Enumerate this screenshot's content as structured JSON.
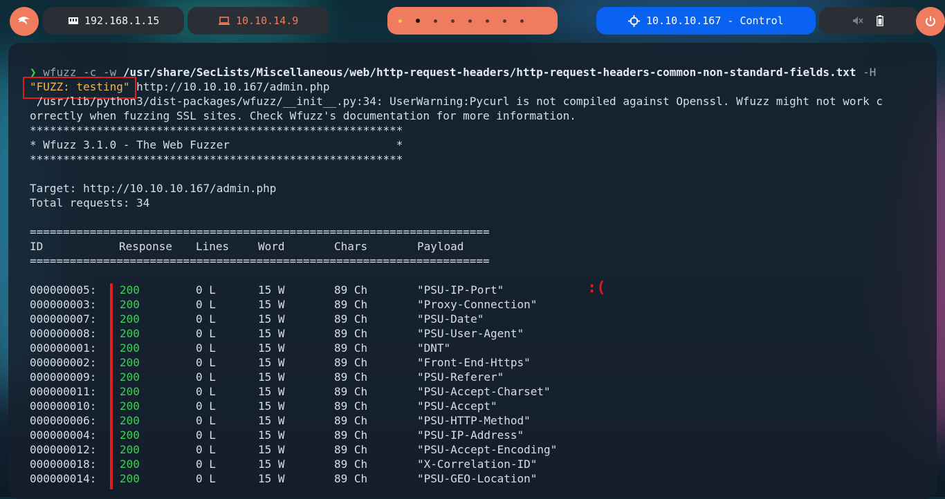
{
  "topbar": {
    "ip_local": "192.168.1.15",
    "ip_vpn": "10.10.14.9",
    "target_label": "10.10.10.167 - Control",
    "workspaces": 8,
    "active_workspace": 2,
    "colors": {
      "accent": "#f07c60",
      "blue": "#0a63f0",
      "dark": "#2a2f36"
    }
  },
  "terminal": {
    "prompt_symbol": "❯",
    "cmd_name": "wfuzz",
    "cmd_flags": " -c -w ",
    "cmd_path": "/usr/share/SecLists/Miscellaneous/web/http-request-headers/http-request-headers-common-non-standard-fields.txt",
    "cmd_h": " -H",
    "cmd_fuzz": "\"FUZZ: testing\"",
    "cmd_url": " http://10.10.10.167/admin.php",
    "warning_1": " /usr/lib/python3/dist-packages/wfuzz/__init__.py:34: UserWarning:Pycurl is not compiled against Openssl. Wfuzz might not work c",
    "warning_2": "orrectly when fuzzing SSL sites. Check Wfuzz's documentation for more information.",
    "stars": "********************************************************",
    "banner": "* Wfuzz 3.1.0 - The Web Fuzzer                         *",
    "target": "Target: http://10.10.10.167/admin.php",
    "total": "Total requests: 34",
    "equals": "=====================================================================",
    "headers": {
      "id": "ID",
      "response": "Response",
      "lines": "Lines",
      "word": "Word",
      "chars": "Chars",
      "payload": "Payload"
    },
    "sad_face": ":(",
    "rows": [
      {
        "id": "000000005:",
        "response": "200",
        "lines": "0 L",
        "word": "15 W",
        "chars": "89 Ch",
        "payload": "\"PSU-IP-Port\""
      },
      {
        "id": "000000003:",
        "response": "200",
        "lines": "0 L",
        "word": "15 W",
        "chars": "89 Ch",
        "payload": "\"Proxy-Connection\""
      },
      {
        "id": "000000007:",
        "response": "200",
        "lines": "0 L",
        "word": "15 W",
        "chars": "89 Ch",
        "payload": "\"PSU-Date\""
      },
      {
        "id": "000000008:",
        "response": "200",
        "lines": "0 L",
        "word": "15 W",
        "chars": "89 Ch",
        "payload": "\"PSU-User-Agent\""
      },
      {
        "id": "000000001:",
        "response": "200",
        "lines": "0 L",
        "word": "15 W",
        "chars": "89 Ch",
        "payload": "\"DNT\""
      },
      {
        "id": "000000002:",
        "response": "200",
        "lines": "0 L",
        "word": "15 W",
        "chars": "89 Ch",
        "payload": "\"Front-End-Https\""
      },
      {
        "id": "000000009:",
        "response": "200",
        "lines": "0 L",
        "word": "15 W",
        "chars": "89 Ch",
        "payload": "\"PSU-Referer\""
      },
      {
        "id": "000000011:",
        "response": "200",
        "lines": "0 L",
        "word": "15 W",
        "chars": "89 Ch",
        "payload": "\"PSU-Accept-Charset\""
      },
      {
        "id": "000000010:",
        "response": "200",
        "lines": "0 L",
        "word": "15 W",
        "chars": "89 Ch",
        "payload": "\"PSU-Accept\""
      },
      {
        "id": "000000006:",
        "response": "200",
        "lines": "0 L",
        "word": "15 W",
        "chars": "89 Ch",
        "payload": "\"PSU-HTTP-Method\""
      },
      {
        "id": "000000004:",
        "response": "200",
        "lines": "0 L",
        "word": "15 W",
        "chars": "89 Ch",
        "payload": "\"PSU-IP-Address\""
      },
      {
        "id": "000000012:",
        "response": "200",
        "lines": "0 L",
        "word": "15 W",
        "chars": "89 Ch",
        "payload": "\"PSU-Accept-Encoding\""
      },
      {
        "id": "000000018:",
        "response": "200",
        "lines": "0 L",
        "word": "15 W",
        "chars": "89 Ch",
        "payload": "\"X-Correlation-ID\""
      },
      {
        "id": "000000014:",
        "response": "200",
        "lines": "0 L",
        "word": "15 W",
        "chars": "89 Ch",
        "payload": "\"PSU-GEO-Location\""
      }
    ]
  }
}
